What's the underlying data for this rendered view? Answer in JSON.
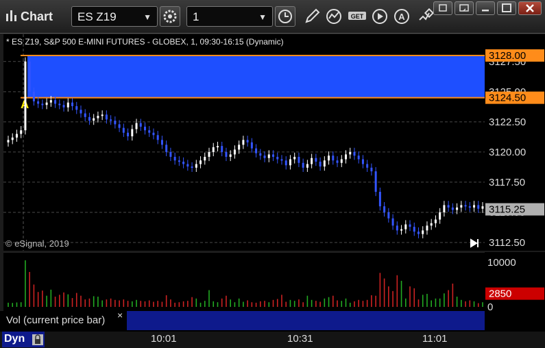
{
  "window": {
    "title": "Chart",
    "symbol": "ES Z19",
    "interval": "1",
    "toolbar_icons": [
      "settings-icon",
      "clock-icon",
      "pencil-icon",
      "study-icon",
      "get-icon",
      "play-icon",
      "alert-icon",
      "link-icon"
    ],
    "window_controls": [
      "minimize-icon",
      "restore-icon",
      "maximize-icon",
      "close-icon"
    ]
  },
  "chart": {
    "header": "* ES Z19, S&P 500 E-MINI FUTURES - GLOBEX, 1, 09:30-16:15 (Dynamic)",
    "watermark": "© eSignal, 2019",
    "alert_marker": "A",
    "zone_top_label": "3128.00",
    "zone_bottom_label": "3124.50",
    "last_price_label": "3115.25",
    "colors": {
      "up": "#ffffff",
      "down": "#3355ff",
      "zone": "#1e4fff",
      "zone_line": "#ff8c1a",
      "vol_up": "#22aa22",
      "vol_down": "#cc2222"
    }
  },
  "chart_data": {
    "type": "candlestick",
    "price_ticks": [
      "3127.50",
      "3125.00",
      "3122.50",
      "3120.00",
      "3117.50",
      "3115.00",
      "3112.50"
    ],
    "price_range": [
      3112.0,
      3129.0
    ],
    "time_ticks": [
      "10:01",
      "10:31",
      "11:01"
    ],
    "closes": [
      3121.0,
      3121.2,
      3121.5,
      3121.8,
      3127.5,
      3125.0,
      3124.2,
      3124.0,
      3123.9,
      3124.1,
      3124.3,
      3124.0,
      3123.9,
      3123.7,
      3124.1,
      3123.8,
      3123.5,
      3123.2,
      3122.9,
      3122.6,
      3122.8,
      3123.0,
      3123.1,
      3122.7,
      3122.6,
      3122.3,
      3122.0,
      3121.6,
      3121.3,
      3121.9,
      3122.4,
      3122.1,
      3121.8,
      3121.6,
      3121.4,
      3121.0,
      3120.6,
      3120.0,
      3119.6,
      3119.3,
      3119.2,
      3119.0,
      3118.8,
      3118.7,
      3119.0,
      3119.3,
      3119.6,
      3120.0,
      3120.4,
      3120.5,
      3120.0,
      3119.6,
      3119.8,
      3120.2,
      3120.6,
      3121.0,
      3120.8,
      3120.3,
      3119.9,
      3119.7,
      3119.5,
      3119.8,
      3119.6,
      3119.4,
      3119.3,
      3118.9,
      3119.4,
      3119.6,
      3119.1,
      3118.7,
      3119.0,
      3119.5,
      3119.2,
      3118.8,
      3119.3,
      3119.7,
      3119.3,
      3119.1,
      3119.4,
      3119.8,
      3120.0,
      3119.7,
      3119.4,
      3119.0,
      3118.7,
      3118.4,
      3116.7,
      3115.5,
      3115.0,
      3114.5,
      3113.9,
      3113.5,
      3113.6,
      3114.0,
      3113.8,
      3113.4,
      3113.2,
      3113.5,
      3113.9,
      3114.1,
      3114.4,
      3115.0,
      3115.6,
      3115.4,
      3115.2,
      3115.4,
      3115.6,
      3115.5,
      3115.4,
      3115.6,
      3115.3,
      3115.5
    ],
    "volumes": [
      900,
      850,
      950,
      1000,
      10000,
      7500,
      4800,
      3200,
      3500,
      2400,
      3700,
      2200,
      2600,
      3100,
      2700,
      1900,
      3000,
      2400,
      1600,
      1800,
      2300,
      2200,
      1400,
      1600,
      1800,
      1500,
      1400,
      1600,
      1300,
      1200,
      1500,
      1300,
      1200,
      1400,
      1100,
      1300,
      1100,
      2500,
      1600,
      900,
      1000,
      1200,
      1300,
      2100,
      1800,
      900,
      1300,
      3600,
      1200,
      1000,
      1800,
      2400,
      1600,
      1000,
      1800,
      1100,
      1400,
      1000,
      900,
      1200,
      1300,
      1000,
      1500,
      1700,
      2600,
      1100,
      1500,
      1300,
      1600,
      1000,
      2400,
      1500,
      1300,
      1100,
      1800,
      2100,
      2400,
      1400,
      1300,
      1800,
      900,
      1200,
      1500,
      1300,
      1500,
      2500,
      2400,
      7300,
      6100,
      4400,
      3400,
      6800,
      5600,
      1800,
      4400,
      4000,
      1600,
      2600,
      2800,
      1400,
      1800,
      1800,
      2900,
      3600,
      5000,
      2200,
      1500,
      1200,
      1400,
      1200,
      800,
      1000
    ],
    "volume_ticks": [
      "10000",
      "0"
    ],
    "volume_current": "2850",
    "volume_range": [
      0,
      10000
    ],
    "zone": [
      3124.5,
      3128.0
    ],
    "last_price": 3115.25
  },
  "bottom": {
    "vol_label": "Vol (current price bar)",
    "dyn_label": "Dyn",
    "close_glyph": "×"
  }
}
